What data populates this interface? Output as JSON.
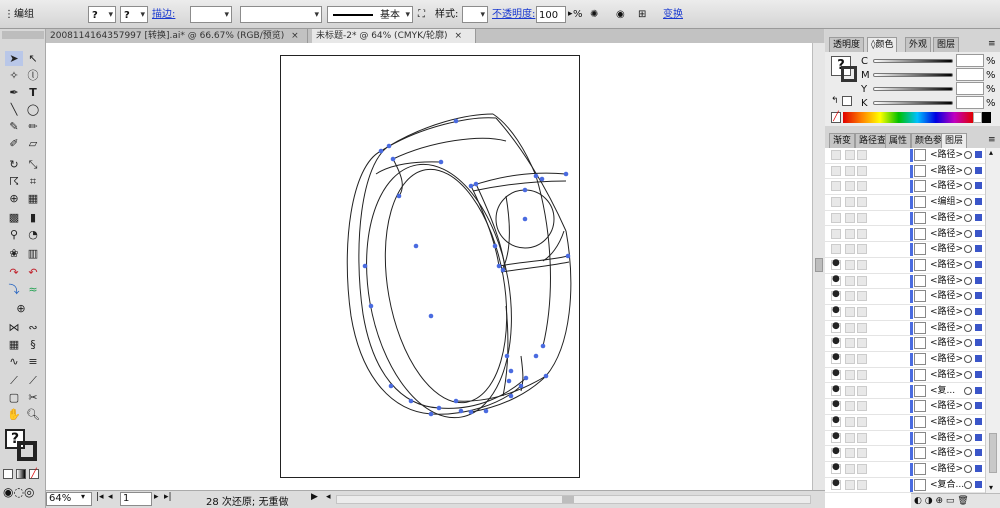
{
  "control_bar": {
    "object_type": "编组",
    "stroke_label": "描边:",
    "stroke_profile": "基本",
    "style_label": "样式:",
    "opacity_label": "不透明度:",
    "opacity_value": "100",
    "opacity_unit": "%",
    "transform_label": "变换"
  },
  "doc_tabs": [
    {
      "label": "2008114164357997 [转换].ai* @ 66.67% (RGB/预览)"
    },
    {
      "label": "未标题-2* @ 64% (CMYK/轮廓)"
    }
  ],
  "right_panel": {
    "top_tabs": [
      "透明度",
      "颜色",
      "外观",
      "图层"
    ],
    "channels": [
      {
        "label": "C",
        "unit": "%"
      },
      {
        "label": "M",
        "unit": "%"
      },
      {
        "label": "Y",
        "unit": "%"
      },
      {
        "label": "K",
        "unit": "%"
      }
    ],
    "lower_tabs": [
      "渐变",
      "路径查",
      "属性",
      "颜色参",
      "图层"
    ]
  },
  "layers": [
    {
      "name": "<路径>",
      "visible": false
    },
    {
      "name": "<路径>",
      "visible": false
    },
    {
      "name": "<路径>",
      "visible": false
    },
    {
      "name": "<编组>",
      "visible": false
    },
    {
      "name": "<路径>",
      "visible": false
    },
    {
      "name": "<路径>",
      "visible": false
    },
    {
      "name": "<路径>",
      "visible": false
    },
    {
      "name": "<路径>",
      "visible": true
    },
    {
      "name": "<路径>",
      "visible": true
    },
    {
      "name": "<路径>",
      "visible": true
    },
    {
      "name": "<路径>",
      "visible": true
    },
    {
      "name": "<路径>",
      "visible": true
    },
    {
      "name": "<路径>",
      "visible": true
    },
    {
      "name": "<路径>",
      "visible": true
    },
    {
      "name": "<路径>",
      "visible": true
    },
    {
      "name": "<复...",
      "visible": true
    },
    {
      "name": "<路径>",
      "visible": true
    },
    {
      "name": "<路径>",
      "visible": true
    },
    {
      "name": "<路径>",
      "visible": true
    },
    {
      "name": "<路径>",
      "visible": true
    },
    {
      "name": "<路径>",
      "visible": true
    },
    {
      "name": "<复合...",
      "visible": true
    }
  ],
  "status": {
    "zoom": "64%",
    "artboard": "1",
    "undo_text": "28 次还原; 无重做"
  },
  "colors": {
    "anchor_blue": "#4a6be0",
    "selection_blue": "#3a55c8",
    "link_blue": "#1b3ad0"
  }
}
